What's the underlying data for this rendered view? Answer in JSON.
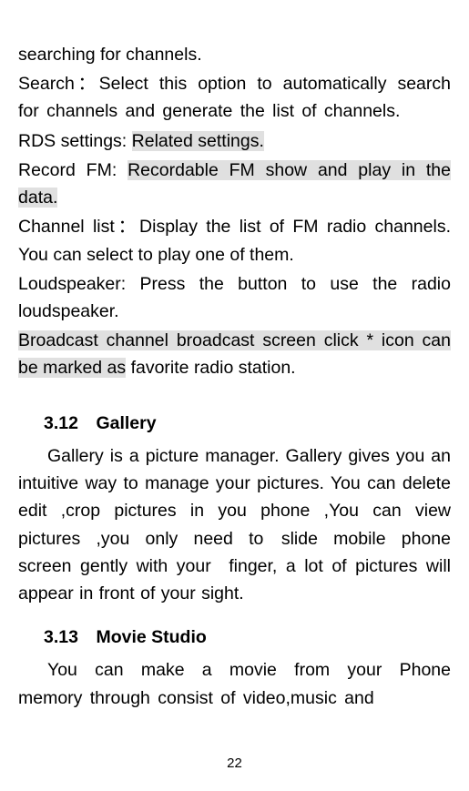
{
  "para_intro": "searching for channels.",
  "para_search": "Search：Select this option to automatically search for channels and generate the list of channels.",
  "rds_prefix": "RDS settings: ",
  "rds_hl": "Related settings.",
  "record_prefix": "Record FM: ",
  "record_hl": "Recordable FM show and play in the data.",
  "para_channellist": "Channel list：Display the list of FM radio channels. You can select to play one of them.",
  "para_loudspeaker": "Loudspeaker: Press the button to use the radio loudspeaker.",
  "broadcast_hl1": "Broadcast channel broadcast screen click * icon can",
  "broadcast_hl2": "be marked as",
  "broadcast_tail": " favorite radio station.",
  "heading_gallery": "3.12 Gallery",
  "para_gallery": "Gallery is a picture manager. Gallery gives you an intuitive way to manage your pictures. You can delete edit ,crop pictures in you phone ,You can view pictures ,you only need to slide mobile phone screen gently with your finger, a lot of pictures will appear in front of your sight.",
  "heading_movie": "3.13 Movie Studio",
  "para_movie": "You can make a movie from your Phone memory through consist of video,music and",
  "page_number": "22"
}
